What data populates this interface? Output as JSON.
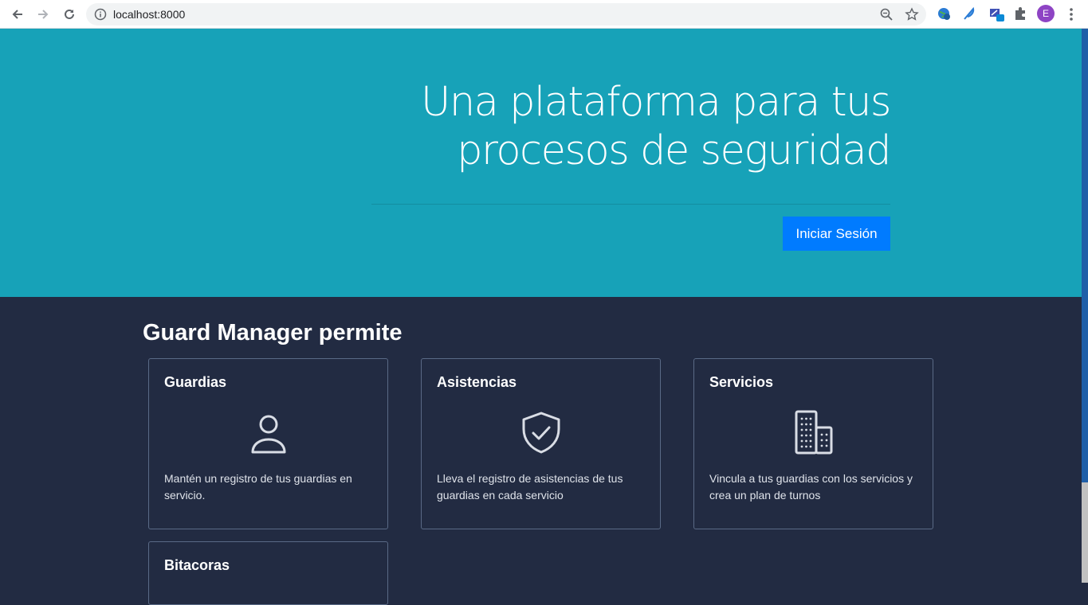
{
  "browser": {
    "url": "localhost:8000",
    "avatar_letter": "E"
  },
  "hero": {
    "title_line1": "Una plataforma para tus",
    "title_line2": "procesos de seguridad",
    "login_label": "Iniciar Sesión",
    "bg_color": "#17a2b8",
    "button_color": "#007bff"
  },
  "features": {
    "heading": "Guard Manager permite",
    "cards": [
      {
        "title": "Guardias",
        "icon": "user-icon",
        "desc": "Mantén un registro de tus guardias en servicio."
      },
      {
        "title": "Asistencias",
        "icon": "shield-check-icon",
        "desc": "Lleva el registro de asistencias de tus guardias en cada servicio"
      },
      {
        "title": "Servicios",
        "icon": "buildings-icon",
        "desc": "Vincula a tus guardias con los servicios y crea un plan de turnos"
      },
      {
        "title": "Bitacoras",
        "icon": "",
        "desc": ""
      }
    ]
  }
}
